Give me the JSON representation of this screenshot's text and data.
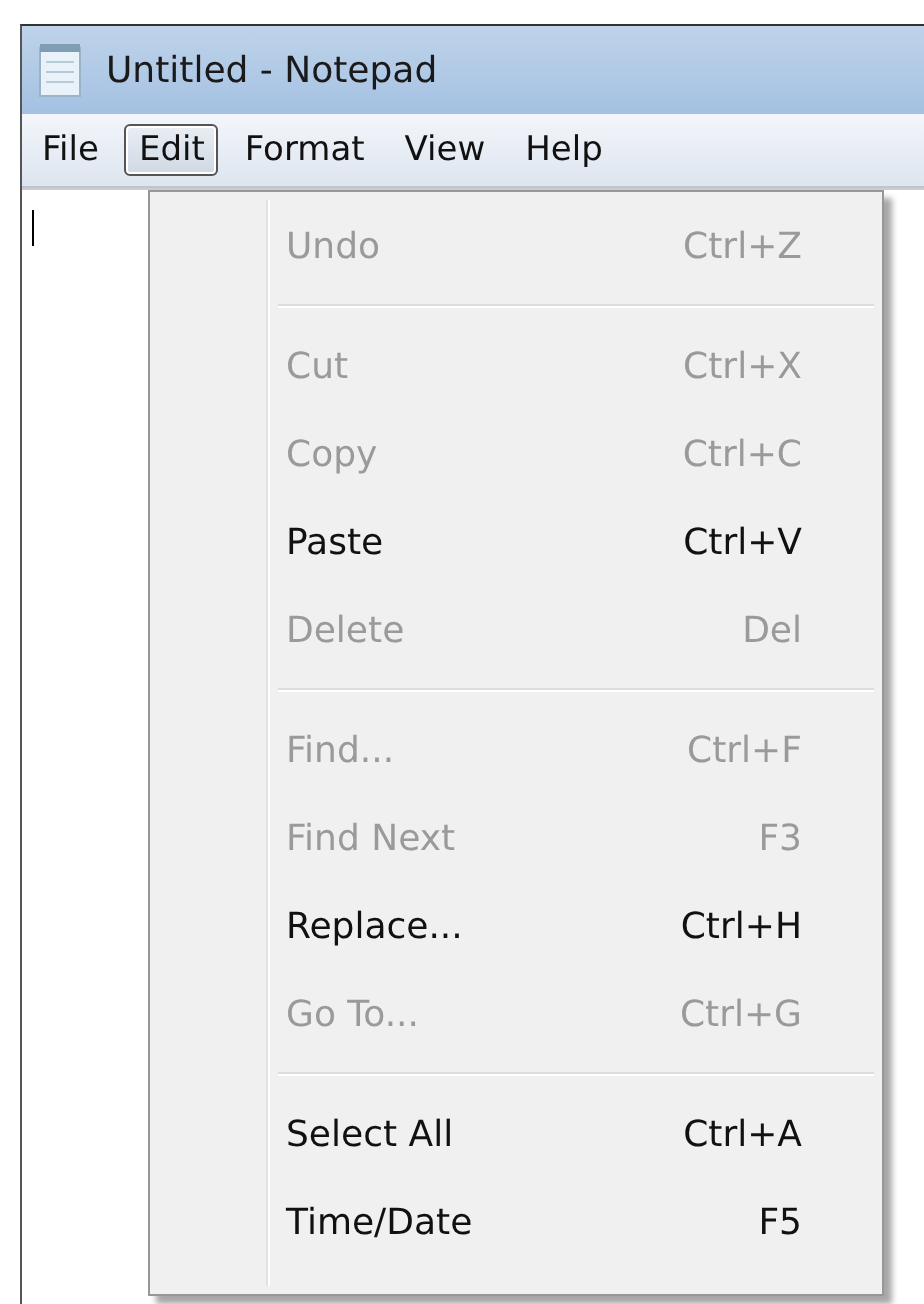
{
  "window": {
    "title": "Untitled - Notepad"
  },
  "menubar": [
    {
      "label": "File",
      "selected": false
    },
    {
      "label": "Edit",
      "selected": true
    },
    {
      "label": "Format",
      "selected": false
    },
    {
      "label": "View",
      "selected": false
    },
    {
      "label": "Help",
      "selected": false
    }
  ],
  "edit_menu": [
    {
      "kind": "item",
      "label": "Undo",
      "shortcut": "Ctrl+Z",
      "disabled": true
    },
    {
      "kind": "separator"
    },
    {
      "kind": "item",
      "label": "Cut",
      "shortcut": "Ctrl+X",
      "disabled": true
    },
    {
      "kind": "item",
      "label": "Copy",
      "shortcut": "Ctrl+C",
      "disabled": true
    },
    {
      "kind": "item",
      "label": "Paste",
      "shortcut": "Ctrl+V",
      "disabled": false
    },
    {
      "kind": "item",
      "label": "Delete",
      "shortcut": "Del",
      "disabled": true
    },
    {
      "kind": "separator"
    },
    {
      "kind": "item",
      "label": "Find...",
      "shortcut": "Ctrl+F",
      "disabled": true
    },
    {
      "kind": "item",
      "label": "Find Next",
      "shortcut": "F3",
      "disabled": true
    },
    {
      "kind": "item",
      "label": "Replace...",
      "shortcut": "Ctrl+H",
      "disabled": false
    },
    {
      "kind": "item",
      "label": "Go To...",
      "shortcut": "Ctrl+G",
      "disabled": true
    },
    {
      "kind": "separator"
    },
    {
      "kind": "item",
      "label": "Select All",
      "shortcut": "Ctrl+A",
      "disabled": false
    },
    {
      "kind": "item",
      "label": "Time/Date",
      "shortcut": "F5",
      "disabled": false
    }
  ]
}
